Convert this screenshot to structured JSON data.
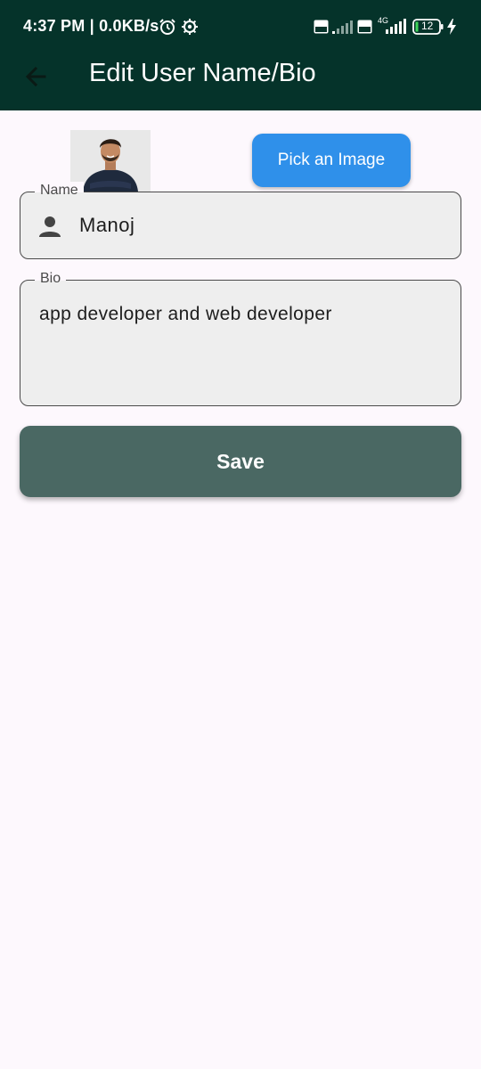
{
  "status_bar": {
    "time_speed": "4:37 PM | 0.0KB/s",
    "battery_level": "12",
    "network_type": "4G",
    "volte_badge": "Vo LTE",
    "icons": [
      "alarm-icon",
      "settings-icon",
      "volte-icon",
      "signal-icon",
      "battery-icon",
      "charging-icon"
    ]
  },
  "app_bar": {
    "title": "Edit User Name/Bio",
    "back_icon": "arrow-back-icon"
  },
  "profile": {
    "pick_image_label": "Pick an Image"
  },
  "form": {
    "name_label": "Name",
    "name_value": "Manoj",
    "name_icon": "person-icon",
    "bio_label": "Bio",
    "bio_value": "app developer and web developer",
    "save_label": "Save"
  },
  "colors": {
    "app_bar_bg": "#05332a",
    "pick_button_bg": "#2f90ea",
    "save_button_bg": "#4a6863",
    "field_bg": "#eeeeee",
    "page_bg": "#fdf8fd"
  }
}
